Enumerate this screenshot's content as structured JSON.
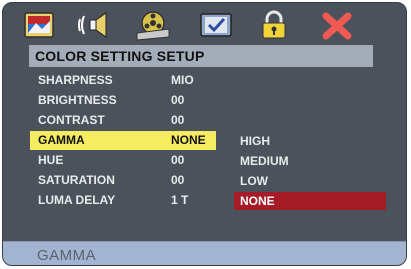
{
  "header": {
    "title": "COLOR SETTING SETUP"
  },
  "tabs": [
    {
      "icon": "picture-monitor-icon"
    },
    {
      "icon": "audio-speaker-icon"
    },
    {
      "icon": "film-reel-icon"
    },
    {
      "icon": "checkmark-screen-icon"
    },
    {
      "icon": "padlock-icon"
    },
    {
      "icon": "close-x-icon"
    }
  ],
  "settings": [
    {
      "label": "SHARPNESS",
      "value": "MIO"
    },
    {
      "label": "BRIGHTNESS",
      "value": "00"
    },
    {
      "label": "CONTRAST",
      "value": "00"
    },
    {
      "label": "GAMMA",
      "value": "NONE",
      "selected": true
    },
    {
      "label": "HUE",
      "value": "00"
    },
    {
      "label": "SATURATION",
      "value": "00"
    },
    {
      "label": "LUMA DELAY",
      "value": "1 T"
    }
  ],
  "options": [
    {
      "label": "HIGH"
    },
    {
      "label": "MEDIUM"
    },
    {
      "label": "LOW"
    },
    {
      "label": "NONE",
      "selected": true
    }
  ],
  "footer": {
    "hint": "GAMMA"
  },
  "colors": {
    "panel": "#4b525b",
    "header_bar": "#a3adba",
    "highlight_yellow": "#f6ec5f",
    "highlight_red": "#a51b27",
    "footer_bar": "#a2b4d0"
  }
}
